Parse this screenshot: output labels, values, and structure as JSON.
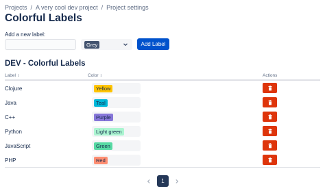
{
  "breadcrumb": [
    "Projects",
    "A very cool dev project",
    "Project settings"
  ],
  "breadcrumb_separator": "/",
  "page_title": "Colorful Labels",
  "form": {
    "add_label_text": "Add a new label:",
    "input_value": "",
    "input_placeholder": "",
    "selected_color": {
      "name": "Grey",
      "bg": "#42526e",
      "fg": "#ffffff"
    },
    "add_button_label": "Add Label"
  },
  "section_title": "DEV - Colorful Labels",
  "table": {
    "columns": {
      "label": "Label",
      "color": "Color",
      "actions": "Actions"
    },
    "rows": [
      {
        "label": "Clojure",
        "color": "Yellow",
        "bg": "#ffc400",
        "fg": "#172b4d"
      },
      {
        "label": "Java",
        "color": "Teal",
        "bg": "#00b8d9",
        "fg": "#172b4d"
      },
      {
        "label": "C++",
        "color": "Purple",
        "bg": "#8777d9",
        "fg": "#172b4d"
      },
      {
        "label": "Python",
        "color": "Light green",
        "bg": "#abf5d1",
        "fg": "#172b4d"
      },
      {
        "label": "JavaScript",
        "color": "Green",
        "bg": "#57d9a3",
        "fg": "#172b4d"
      },
      {
        "label": "PHP",
        "color": "Red",
        "bg": "#ff8f73",
        "fg": "#172b4d"
      }
    ]
  },
  "pagination": {
    "current_page": "1"
  },
  "colors": {
    "primary": "#0052cc",
    "danger": "#de350b",
    "pager_active": "#253858"
  },
  "icons": {
    "delete": "trash-icon",
    "dropdown": "chevron-down-icon",
    "prev": "chevron-left-icon",
    "next": "chevron-right-icon"
  }
}
